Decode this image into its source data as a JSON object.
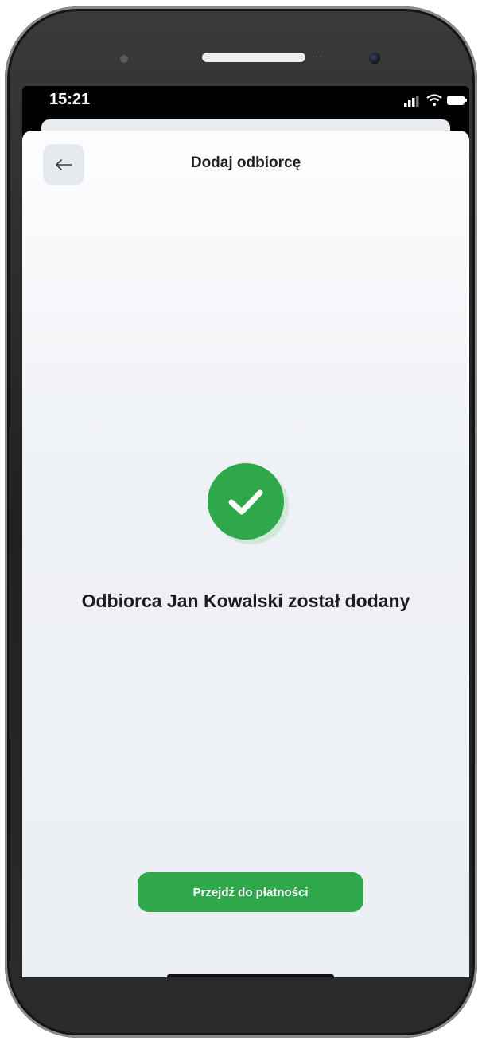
{
  "status_bar": {
    "time": "15:21",
    "icons": [
      "signal-icon",
      "wifi-icon",
      "battery-icon"
    ]
  },
  "header": {
    "back_icon": "arrow-left-icon",
    "title": "Dodaj odbiorcę"
  },
  "confirmation": {
    "icon": "checkmark-icon",
    "message": "Odbiorca Jan Kowalski został dodany"
  },
  "actions": {
    "primary_label": "Przejdź do płatności"
  },
  "colors": {
    "accent": "#2ea84a",
    "text": "#1c1d21",
    "background": "#eef1f5",
    "back_button_bg": "#e6eaee"
  }
}
